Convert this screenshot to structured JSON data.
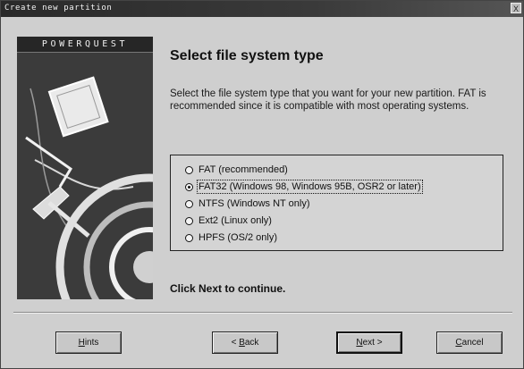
{
  "window": {
    "title": "Create new partition",
    "close_glyph": "X"
  },
  "sidebar": {
    "brand": "POWERQUEST"
  },
  "main": {
    "heading": "Select file system type",
    "description": "Select the file system type that you want for your new partition. FAT is recommended since it is compatible with most operating systems.",
    "options": [
      {
        "label": "FAT (recommended)",
        "selected": false
      },
      {
        "label": "FAT32 (Windows 98, Windows 95B, OSR2 or later)",
        "selected": true
      },
      {
        "label": "NTFS (Windows NT only)",
        "selected": false
      },
      {
        "label": "Ext2 (Linux only)",
        "selected": false
      },
      {
        "label": "HPFS (OS/2 only)",
        "selected": false
      }
    ],
    "footer": "Click Next to continue."
  },
  "buttons": {
    "hints": {
      "mnemonic": "H",
      "rest": "ints"
    },
    "back": {
      "prefix": "< ",
      "mnemonic": "B",
      "rest": "ack"
    },
    "next": {
      "mnemonic": "N",
      "rest": "ext >"
    },
    "cancel": {
      "mnemonic": "C",
      "rest": "ancel"
    }
  },
  "colors": {
    "titlebar": "#2a2a2a",
    "sidebar": "#3b3b3b",
    "dialog_bg": "#cfcfcf"
  }
}
